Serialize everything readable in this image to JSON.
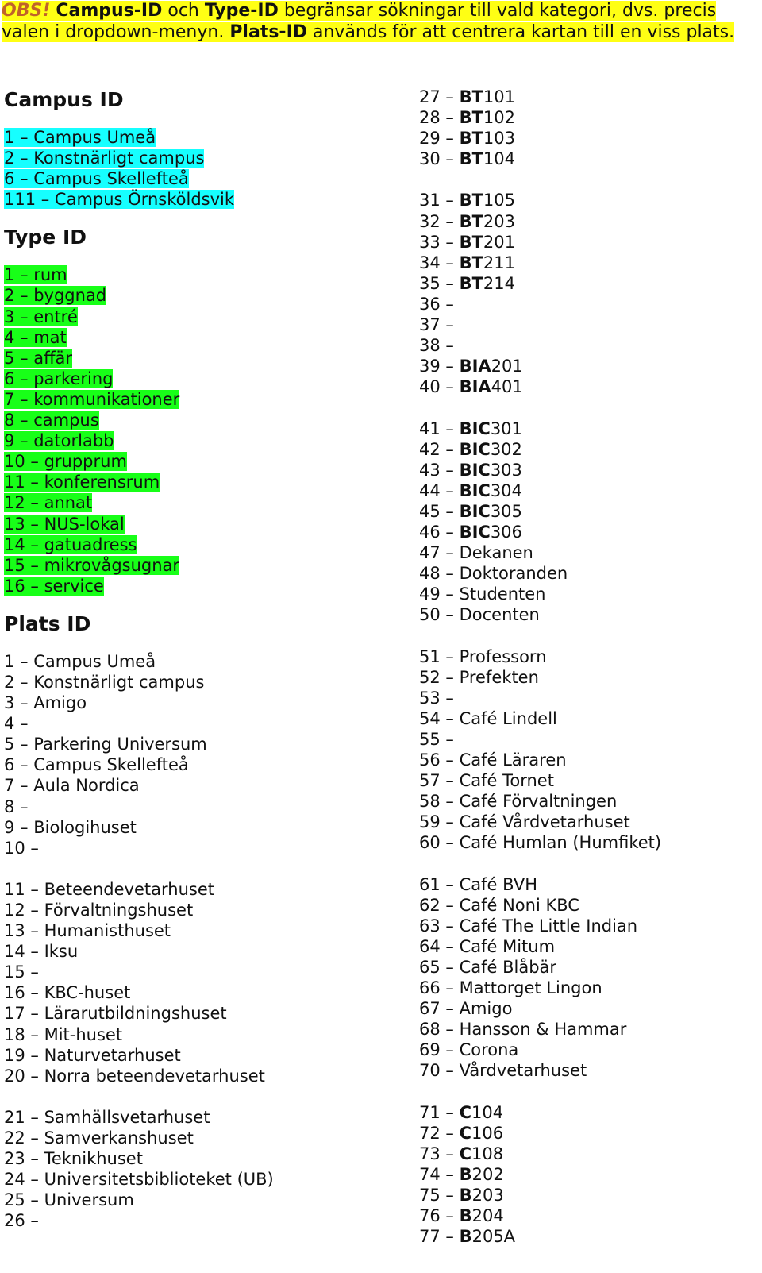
{
  "note": {
    "obs": "OBS!",
    "campus_id": "Campus-ID",
    "and": " och ",
    "type_id": "Type-ID",
    "text1": " begränsar sökningar till vald kategori, dvs. precis valen i dropdown-menyn. ",
    "plats_id": "Plats-ID",
    "text2": " används för att centrera kartan till en viss plats."
  },
  "colors": {
    "note_highlight": "#ffff14",
    "obs": "#c0622a",
    "campus_highlight": "#16ffff",
    "type_highlight": "#18ff18"
  },
  "campus": {
    "title": "Campus ID",
    "items": [
      "1 – Campus Umeå",
      "2 – Konstnärligt campus",
      "6 – Campus Skellefteå",
      "111 – Campus Örnsköldsvik"
    ]
  },
  "type": {
    "title": "Type ID",
    "items": [
      "1 – rum",
      "2 – byggnad",
      "3 – entré",
      "4 – mat",
      "5 – affär",
      "6 – parkering",
      "7 – kommunikationer",
      "8 – campus",
      "9 – datorlabb",
      "10 – grupprum",
      "11 – konferensrum",
      "12 – annat",
      "13 – NUS-lokal",
      "14 – gatuadress",
      "15 – mikrovågsugnar",
      "16 – service"
    ]
  },
  "plats": {
    "title": "Plats ID",
    "items": [
      {
        "num": "1 – ",
        "bold": "",
        "rest": "Campus Umeå"
      },
      {
        "num": "2 – ",
        "bold": "",
        "rest": "Konstnärligt campus"
      },
      {
        "num": "3 – ",
        "bold": "",
        "rest": "Amigo"
      },
      {
        "num": "4 – ",
        "bold": "",
        "rest": ""
      },
      {
        "num": "5 – ",
        "bold": "",
        "rest": "Parkering Universum"
      },
      {
        "num": "6 – ",
        "bold": "",
        "rest": "Campus Skellefteå"
      },
      {
        "num": "7 – ",
        "bold": "",
        "rest": "Aula Nordica"
      },
      {
        "num": "8 – ",
        "bold": "",
        "rest": ""
      },
      {
        "num": "9 – ",
        "bold": "",
        "rest": "Biologihuset"
      },
      {
        "num": "10 – ",
        "bold": "",
        "rest": ""
      },
      {
        "num": "11 – ",
        "bold": "",
        "rest": "Beteendevetarhuset"
      },
      {
        "num": "12 – ",
        "bold": "",
        "rest": "Förvaltningshuset"
      },
      {
        "num": "13 – ",
        "bold": "",
        "rest": "Humanisthuset"
      },
      {
        "num": "14 – ",
        "bold": "",
        "rest": "Iksu"
      },
      {
        "num": "15 – ",
        "bold": "",
        "rest": ""
      },
      {
        "num": "16 – ",
        "bold": "",
        "rest": "KBC-huset"
      },
      {
        "num": "17 – ",
        "bold": "",
        "rest": "Lärarutbildningshuset"
      },
      {
        "num": "18 – ",
        "bold": "",
        "rest": "Mit-huset"
      },
      {
        "num": "19 – ",
        "bold": "",
        "rest": "Naturvetarhuset"
      },
      {
        "num": "20 – ",
        "bold": "",
        "rest": "Norra beteendevetarhuset"
      },
      {
        "num": "21 – ",
        "bold": "",
        "rest": "Samhällsvetarhuset"
      },
      {
        "num": "22 – ",
        "bold": "",
        "rest": "Samverkanshuset"
      },
      {
        "num": "23 – ",
        "bold": "",
        "rest": "Teknikhuset"
      },
      {
        "num": "24 – ",
        "bold": "",
        "rest": "Universitetsbiblioteket (UB)"
      },
      {
        "num": "25 – ",
        "bold": "",
        "rest": "Universum"
      },
      {
        "num": "26 – ",
        "bold": "",
        "rest": ""
      },
      {
        "num": "27 – ",
        "bold": "BT",
        "rest": "101"
      },
      {
        "num": "28 – ",
        "bold": "BT",
        "rest": "102"
      },
      {
        "num": "29 – ",
        "bold": "BT",
        "rest": "103"
      },
      {
        "num": "30 – ",
        "bold": "BT",
        "rest": "104"
      },
      {
        "num": "31 – ",
        "bold": "BT",
        "rest": "105"
      },
      {
        "num": "32 – ",
        "bold": "BT",
        "rest": "203"
      },
      {
        "num": "33 – ",
        "bold": "BT",
        "rest": "201"
      },
      {
        "num": "34 – ",
        "bold": "BT",
        "rest": "211"
      },
      {
        "num": "35 – ",
        "bold": "BT",
        "rest": "214"
      },
      {
        "num": "36 – ",
        "bold": "",
        "rest": ""
      },
      {
        "num": "37 – ",
        "bold": "",
        "rest": ""
      },
      {
        "num": "38 – ",
        "bold": "",
        "rest": ""
      },
      {
        "num": "39 – ",
        "bold": "BIA",
        "rest": "201"
      },
      {
        "num": "40 – ",
        "bold": "BIA",
        "rest": "401"
      },
      {
        "num": "41 – ",
        "bold": "BIC",
        "rest": "301"
      },
      {
        "num": "42 – ",
        "bold": "BIC",
        "rest": "302"
      },
      {
        "num": "43 – ",
        "bold": "BIC",
        "rest": "303"
      },
      {
        "num": "44 – ",
        "bold": "BIC",
        "rest": "304"
      },
      {
        "num": "45 – ",
        "bold": "BIC",
        "rest": "305"
      },
      {
        "num": "46 – ",
        "bold": "BIC",
        "rest": "306"
      },
      {
        "num": "47 – ",
        "bold": "",
        "rest": "Dekanen"
      },
      {
        "num": "48 – ",
        "bold": "",
        "rest": "Doktoranden"
      },
      {
        "num": "49 – ",
        "bold": "",
        "rest": "Studenten"
      },
      {
        "num": "50 – ",
        "bold": "",
        "rest": "Docenten"
      },
      {
        "num": "51 – ",
        "bold": "",
        "rest": "Professorn"
      },
      {
        "num": "52 – ",
        "bold": "",
        "rest": "Prefekten"
      },
      {
        "num": "53 – ",
        "bold": "",
        "rest": ""
      },
      {
        "num": "54 – ",
        "bold": "",
        "rest": "Café Lindell"
      },
      {
        "num": "55 – ",
        "bold": "",
        "rest": ""
      },
      {
        "num": "56 – ",
        "bold": "",
        "rest": "Café Läraren"
      },
      {
        "num": "57 – ",
        "bold": "",
        "rest": "Café Tornet"
      },
      {
        "num": "58 – ",
        "bold": "",
        "rest": "Café Förvaltningen"
      },
      {
        "num": "59 – ",
        "bold": "",
        "rest": "Café Vårdvetarhuset"
      },
      {
        "num": "60 – ",
        "bold": "",
        "rest": "Café Humlan (Humfiket)"
      },
      {
        "num": "61 – ",
        "bold": "",
        "rest": "Café BVH"
      },
      {
        "num": "62 – ",
        "bold": "",
        "rest": "Café Noni KBC"
      },
      {
        "num": "63 – ",
        "bold": "",
        "rest": "Café The Little Indian"
      },
      {
        "num": "64 – ",
        "bold": "",
        "rest": "Café Mitum"
      },
      {
        "num": "65 – ",
        "bold": "",
        "rest": "Café Blåbär"
      },
      {
        "num": "66 – ",
        "bold": "",
        "rest": "Mattorget Lingon"
      },
      {
        "num": "67 – ",
        "bold": "",
        "rest": "Amigo"
      },
      {
        "num": "68 – ",
        "bold": "",
        "rest": "Hansson & Hammar"
      },
      {
        "num": "69 – ",
        "bold": "",
        "rest": "Corona"
      },
      {
        "num": "70 – ",
        "bold": "",
        "rest": "Vårdvetarhuset"
      },
      {
        "num": "71 – ",
        "bold": "C",
        "rest": "104"
      },
      {
        "num": "72 – ",
        "bold": "C",
        "rest": "106"
      },
      {
        "num": "73 – ",
        "bold": "C",
        "rest": "108"
      },
      {
        "num": "74 – ",
        "bold": "B",
        "rest": "202"
      },
      {
        "num": "75 – ",
        "bold": "B",
        "rest": "203"
      },
      {
        "num": "76 – ",
        "bold": "B",
        "rest": "204"
      },
      {
        "num": "77 – ",
        "bold": "B",
        "rest": "205A"
      }
    ]
  }
}
